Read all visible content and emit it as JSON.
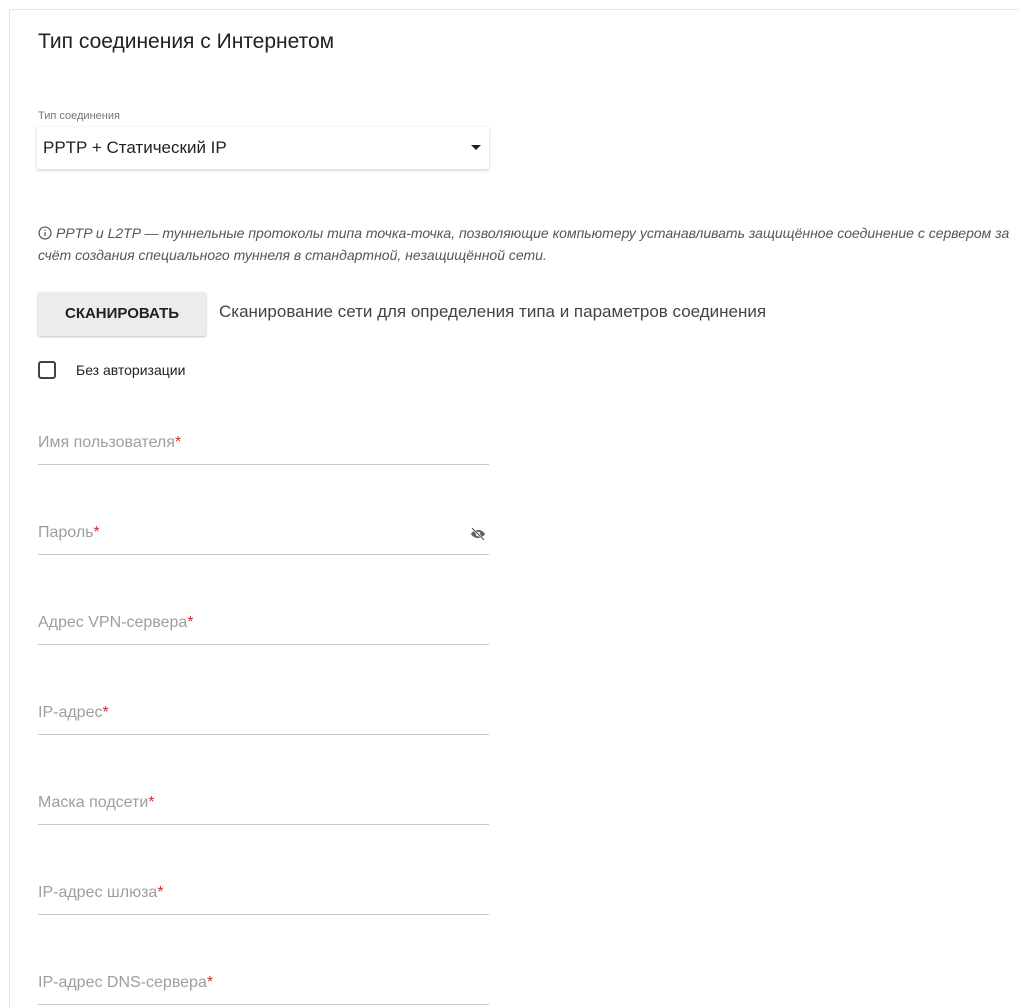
{
  "section": {
    "title": "Тип соединения с Интернетом"
  },
  "connection_type": {
    "label": "Тип соединения",
    "value": "PPTP + Статический IP"
  },
  "info": {
    "icon": "info-circle-icon",
    "text": "PPTP и L2TP — туннельные протоколы типа точка-точка, позволяющие компьютеру устанавливать защищённое соединение с сервером за счёт создания специального туннеля в стандартной, незащищённой сети."
  },
  "scan": {
    "button_label": "СКАНИРОВАТЬ",
    "description": "Сканирование сети для определения типа и параметров соединения"
  },
  "no_auth": {
    "label": "Без авторизации",
    "checked": false
  },
  "fields": {
    "username": {
      "label": "Имя пользователя",
      "required_mark": "*"
    },
    "password": {
      "label": "Пароль",
      "required_mark": "*",
      "icon": "eye-off-icon"
    },
    "vpn_server": {
      "label": "Адрес VPN-сервера",
      "required_mark": "*"
    },
    "ip_address": {
      "label": "IP-адрес",
      "required_mark": "*"
    },
    "subnet_mask": {
      "label": "Маска подсети",
      "required_mark": "*"
    },
    "gateway": {
      "label": "IP-адрес шлюза",
      "required_mark": "*"
    },
    "dns_server": {
      "label": "IP-адрес DNS-сервера",
      "required_mark": "*"
    }
  },
  "colors": {
    "required": "#d32f2f",
    "button_bg": "#ececec",
    "underline": "#c9c9c9"
  }
}
